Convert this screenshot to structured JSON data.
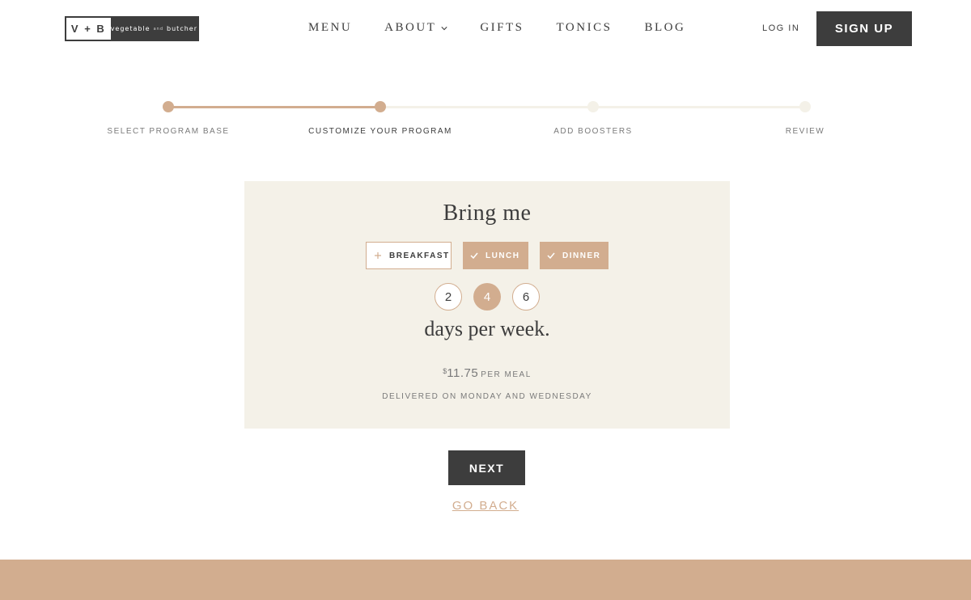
{
  "brand": {
    "mark": "V + B",
    "name_part1": "vegetable",
    "name_amp": "and",
    "name_part2": "butcher"
  },
  "nav": {
    "items": [
      {
        "label": "MENU",
        "has_dropdown": false
      },
      {
        "label": "ABOUT",
        "has_dropdown": true
      },
      {
        "label": "GIFTS",
        "has_dropdown": false
      },
      {
        "label": "TONICS",
        "has_dropdown": false
      },
      {
        "label": "BLOG",
        "has_dropdown": false
      }
    ],
    "login_label": "LOG IN",
    "signup_label": "SIGN UP"
  },
  "progress": {
    "current_step_index": 1,
    "steps": [
      {
        "label": "SELECT PROGRAM BASE",
        "state": "complete"
      },
      {
        "label": "CUSTOMIZE YOUR PROGRAM",
        "state": "current"
      },
      {
        "label": "ADD BOOSTERS",
        "state": "upcoming"
      },
      {
        "label": "REVIEW",
        "state": "upcoming"
      }
    ]
  },
  "selector": {
    "title": "Bring me",
    "meals": [
      {
        "label": "BREAKFAST",
        "selected": false,
        "icon": "plus-icon"
      },
      {
        "label": "LUNCH",
        "selected": true,
        "icon": "check-icon"
      },
      {
        "label": "DINNER",
        "selected": true,
        "icon": "check-icon"
      }
    ],
    "day_options": [
      {
        "label": "2",
        "selected": false
      },
      {
        "label": "4",
        "selected": true
      },
      {
        "label": "6",
        "selected": false
      }
    ],
    "days_text": "days per week.",
    "price_currency": "$",
    "price_amount": "11.75",
    "price_unit": "PER MEAL",
    "delivery_text": "DELIVERED ON MONDAY AND WEDNESDAY"
  },
  "actions": {
    "next_label": "NEXT",
    "back_label": "GO BACK"
  },
  "colors": {
    "accent": "#d2ad8f",
    "dark": "#3d3d3d",
    "card_bg": "#f4f1e8"
  }
}
